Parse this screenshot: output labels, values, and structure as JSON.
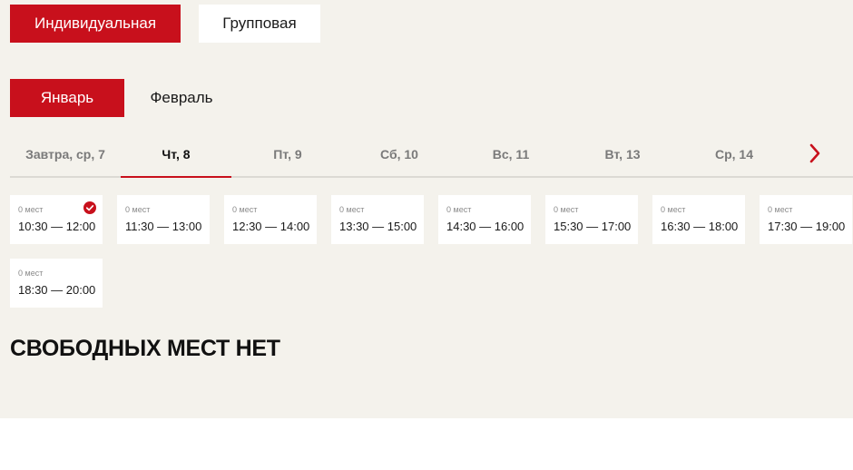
{
  "booking_type": {
    "individual_label": "Индивидуальная",
    "group_label": "Групповая",
    "selected": "individual"
  },
  "months": {
    "january_label": "Январь",
    "february_label": "Февраль",
    "selected": "january"
  },
  "day_tabs": [
    {
      "label": "Завтра, ср, 7",
      "active": false
    },
    {
      "label": "Чт, 8",
      "active": true
    },
    {
      "label": "Пт, 9",
      "active": false
    },
    {
      "label": "Сб, 10",
      "active": false
    },
    {
      "label": "Вс, 11",
      "active": false
    },
    {
      "label": "Вт, 13",
      "active": false
    },
    {
      "label": "Ср, 14",
      "active": false
    }
  ],
  "next_icon": "chevron-right-icon",
  "slots": [
    {
      "seats": "0 мест",
      "time": "10:30 — 12:00",
      "selected": true
    },
    {
      "seats": "0 мест",
      "time": "11:30 — 13:00",
      "selected": false
    },
    {
      "seats": "0 мест",
      "time": "12:30 — 14:00",
      "selected": false
    },
    {
      "seats": "0 мест",
      "time": "13:30 — 15:00",
      "selected": false
    },
    {
      "seats": "0 мест",
      "time": "14:30 — 16:00",
      "selected": false
    },
    {
      "seats": "0 мест",
      "time": "15:30 — 17:00",
      "selected": false
    },
    {
      "seats": "0 мест",
      "time": "16:30 — 18:00",
      "selected": false
    },
    {
      "seats": "0 мест",
      "time": "17:30 — 19:00",
      "selected": false
    },
    {
      "seats": "0 мест",
      "time": "18:30 — 20:00",
      "selected": false
    }
  ],
  "status_message": "СВОБОДНЫХ МЕСТ НЕТ",
  "colors": {
    "accent": "#c8101c",
    "panel_background": "#f4f2ec",
    "card_background": "#ffffff"
  }
}
